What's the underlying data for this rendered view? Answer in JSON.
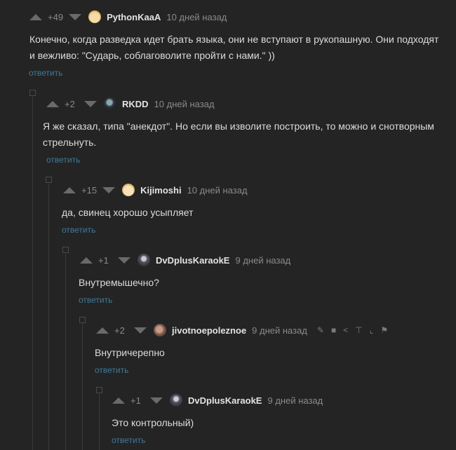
{
  "comments": [
    {
      "score": "+49",
      "user": "PythonKaaA",
      "time": "10 дней назад",
      "text": "Конечно, когда разведка идет брать языка, они не вступают в рукопашную. Они подходят и вежливо: \"Сударь, соблаговолите пройти с нами.\" ))",
      "reply": "ответить"
    },
    {
      "score": "+2",
      "user": "RKDD",
      "time": "10 дней назад",
      "text": "Я же сказал, типа \"анекдот\". Но если вы изволите построить, то можно и снотворным стрельнуть.",
      "reply": "ответить"
    },
    {
      "score": "+15",
      "user": "Kijimoshi",
      "time": "10 дней назад",
      "text": "да, свинец хорошо усыпляет",
      "reply": "ответить"
    },
    {
      "score": "+1",
      "user": "DvDplusKaraokE",
      "time": "9 дней назад",
      "text": "Внутремышечно?",
      "reply": "ответить"
    },
    {
      "score": "+2",
      "user": "jivotnoepoleznoe",
      "time": "9 дней назад",
      "text": "Внутричерепно",
      "reply": "ответить"
    },
    {
      "score": "+1",
      "user": "DvDplusKaraokE",
      "time": "9 дней назад",
      "text": "Это контрольный)",
      "reply": "ответить"
    }
  ],
  "colors": {
    "background": "#242424",
    "link": "#3f7a9a",
    "muted": "#8a8a8a"
  },
  "icons": [
    "upvote-icon",
    "downvote-icon",
    "edit-icon",
    "save-icon",
    "share-icon",
    "pin-top-icon",
    "branch-icon",
    "flag-icon"
  ]
}
